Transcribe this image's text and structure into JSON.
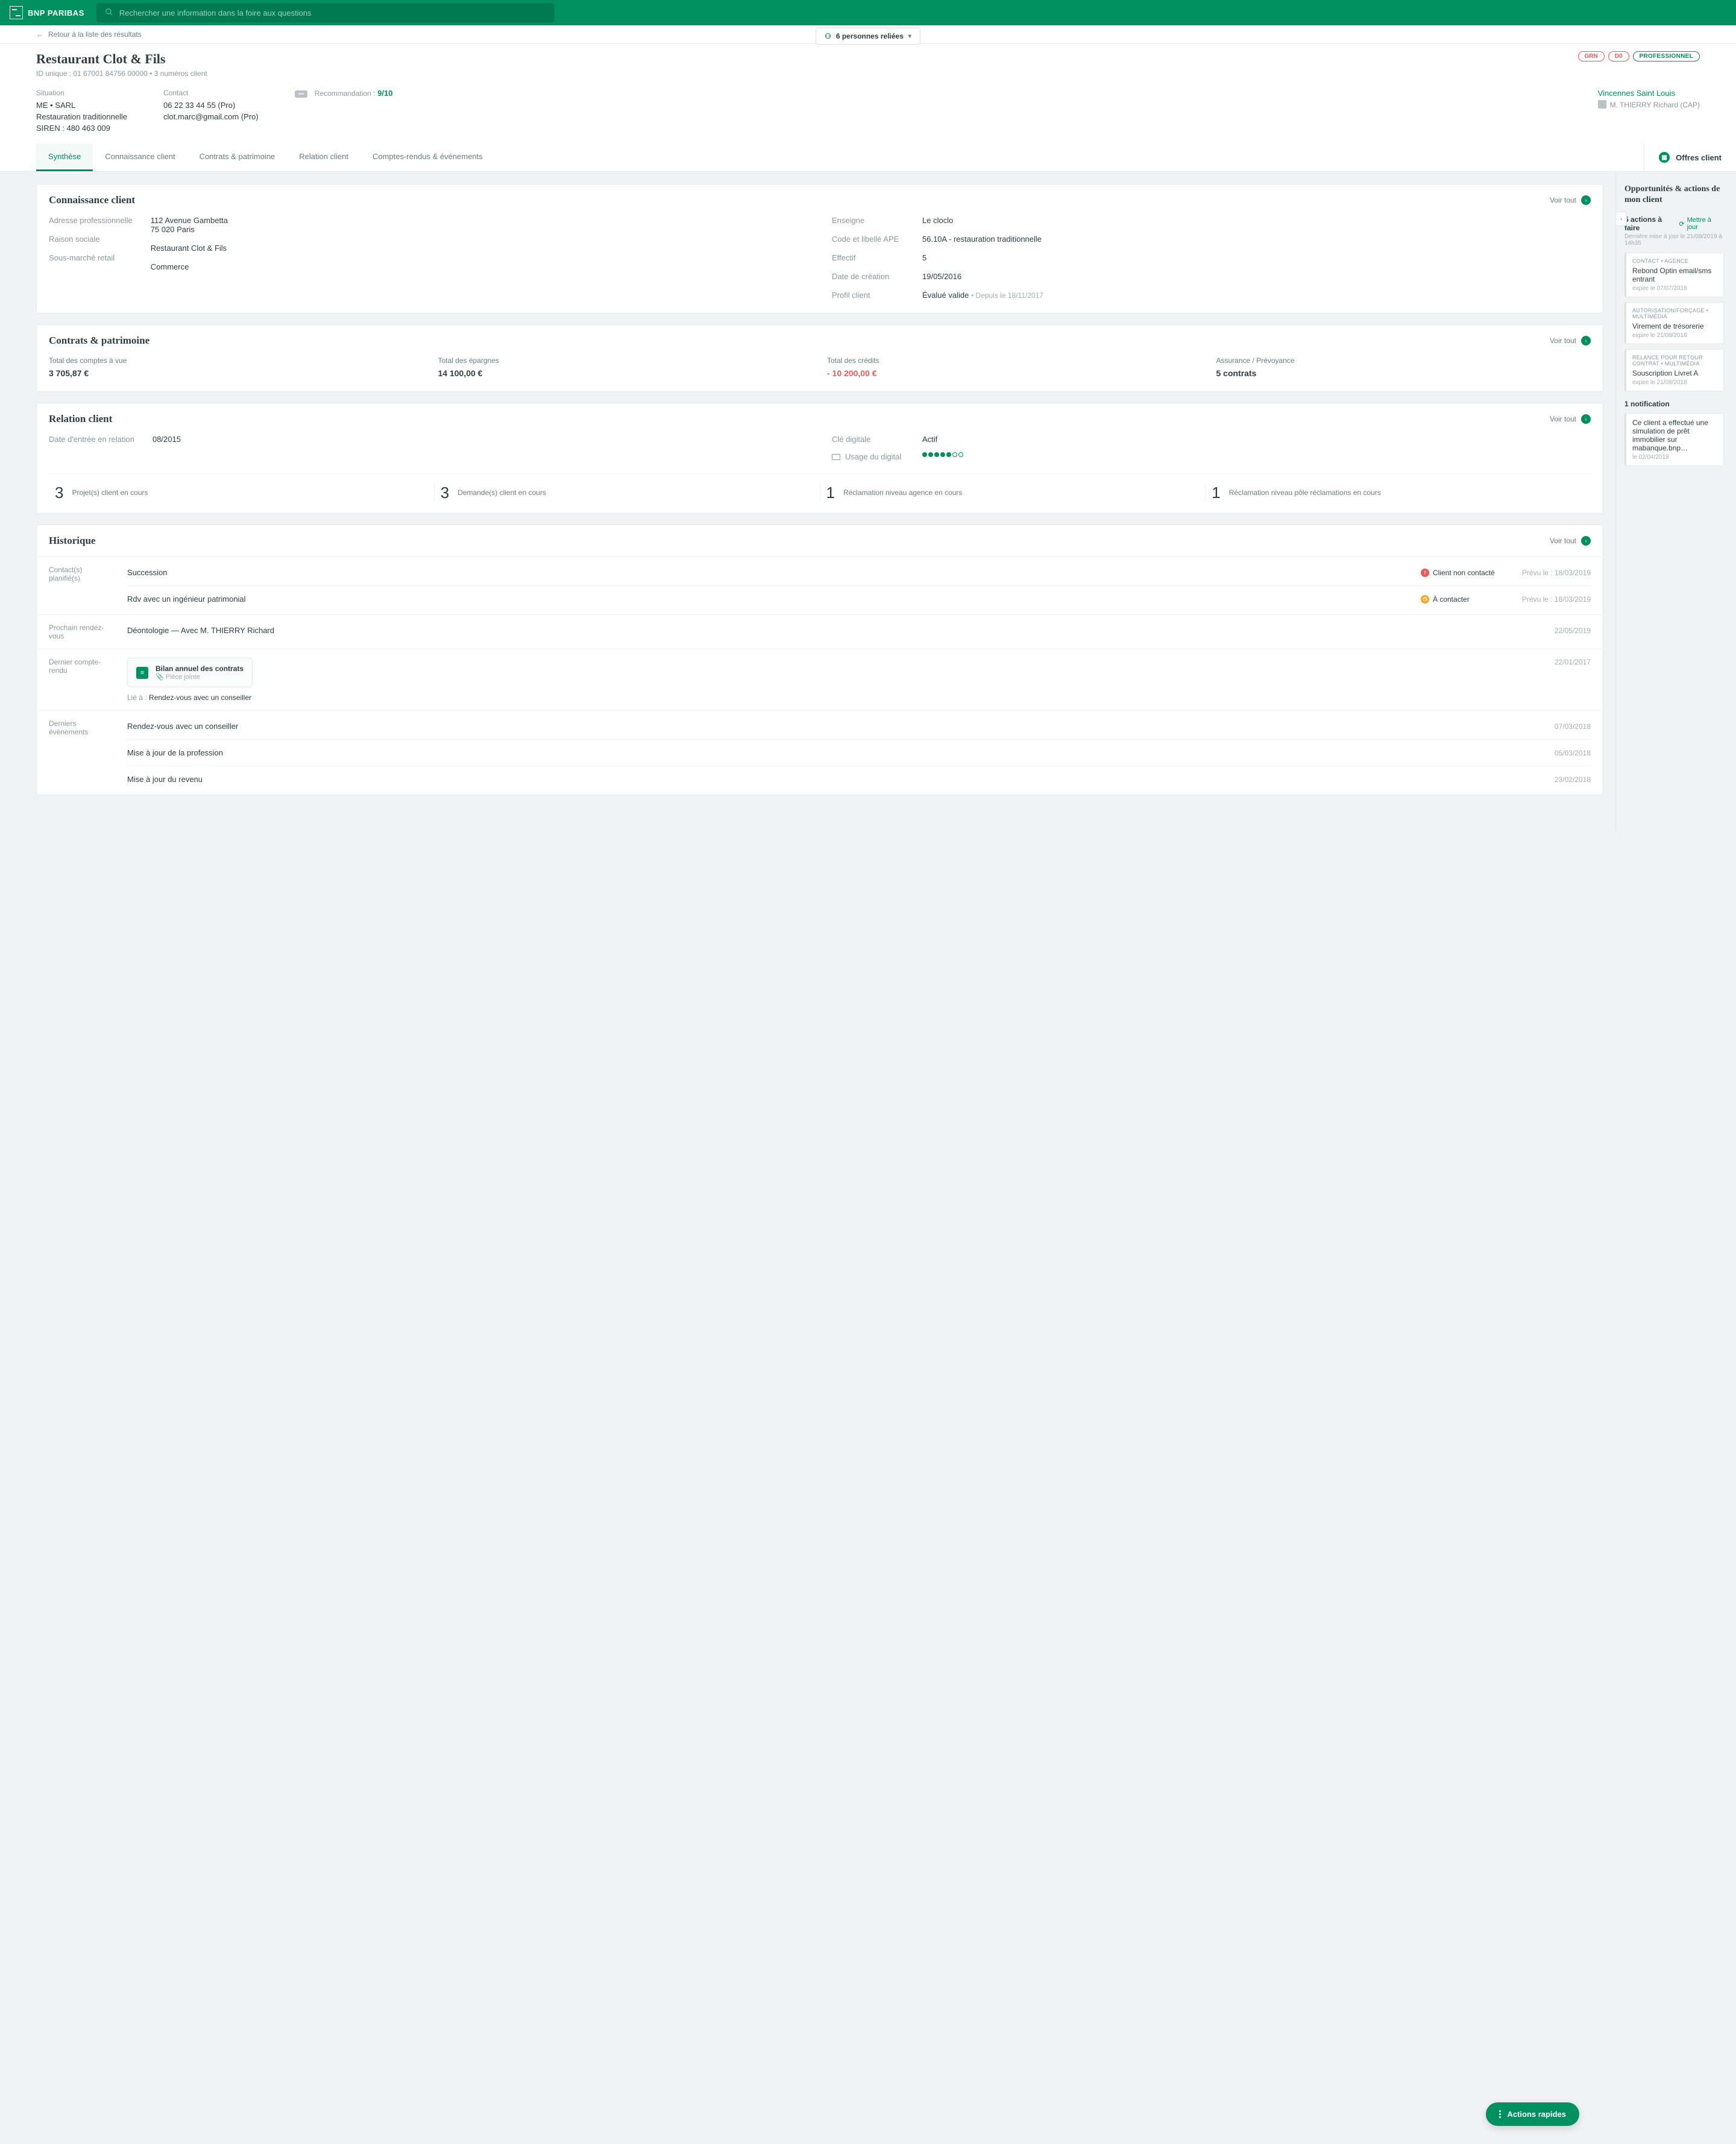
{
  "header": {
    "brand": "BNP PARIBAS",
    "search_placeholder": "Rechercher une information dans la foire aux questions"
  },
  "subbar": {
    "back": "Retour à la liste des résultats",
    "persons": "6 personnes reliées"
  },
  "client": {
    "name": "Restaurant Clot & Fils",
    "id_line": "ID unique : 01 67001 84756 00000 • 3 numéros client",
    "badges": {
      "grn": "GRN",
      "d0": "D0",
      "pro": "PROFESSIONNEL"
    },
    "situation_label": "Situation",
    "situation": "ME • SARL",
    "activity": "Restauration traditionnelle",
    "siren": "SIREN : 480 463 009",
    "contact_label": "Contact",
    "phone": "06 22 33 44 55 (Pro)",
    "email": "clot.marc@gmail.com (Pro)",
    "reco_label": "Recommandation :",
    "reco_value": "9/10",
    "agency": "Vincennes Saint Louis",
    "advisor": "M. THIERRY Richard (CAP)"
  },
  "tabs": [
    "Synthèse",
    "Connaissance client",
    "Contrats & patrimoine",
    "Relation client",
    "Comptes-rendus & événements"
  ],
  "offers_tab": "Offres client",
  "kc": {
    "title": "Connaissance client",
    "see_all": "Voir tout",
    "labels_left": [
      "Adresse professionnelle",
      "Raison sociale",
      "Sous-marché retail"
    ],
    "values_left": [
      "112 Avenue Gambetta\n75 020 Paris",
      "Restaurant Clot & Fils",
      "Commerce"
    ],
    "labels_right": [
      "Enseigne",
      "Code et libellé APE",
      "Effectif",
      "Date de création",
      "Profil client"
    ],
    "values_right": [
      "Le cloclo",
      "56.10A - restauration traditionnelle",
      "5",
      "19/05/2016"
    ],
    "profil_val": "Évalué valide",
    "profil_since": "• Depuis le 18/11/2017"
  },
  "cp": {
    "title": "Contrats & patrimoine",
    "see_all": "Voir tout",
    "items": [
      {
        "label": "Total des comptes à vue",
        "value": "3 705,87 €"
      },
      {
        "label": "Total des épargnes",
        "value": "14 100,00 €"
      },
      {
        "label": "Total des crédits",
        "value": "- 10 200,00 €",
        "neg": true
      },
      {
        "label": "Assurance / Prévoyance",
        "value": "5 contrats"
      }
    ]
  },
  "rc": {
    "title": "Relation client",
    "see_all": "Voir tout",
    "labels_left": [
      "Date d'entrée en relation"
    ],
    "values_left": [
      "08/2015"
    ],
    "cle_label": "Clé digitale",
    "cle_val": "Actif",
    "usage_label": "Usage du digital",
    "usage_filled": 5,
    "usage_total": 7,
    "stats": [
      {
        "n": "3",
        "t": "Projet(s) client en cours"
      },
      {
        "n": "3",
        "t": "Demande(s) client en cours"
      },
      {
        "n": "1",
        "t": "Réclamation niveau agence en cours"
      },
      {
        "n": "1",
        "t": "Réclamation niveau pôle réclamations en cours"
      }
    ]
  },
  "hist": {
    "title": "Historique",
    "see_all": "Voir tout",
    "contacts_label": "Contact(s) planifié(s)",
    "contacts": [
      {
        "title": "Succession",
        "status": "Client non contacté",
        "status_type": "red",
        "date": "Prévu le : 18/03/2019"
      },
      {
        "title": "Rdv avec un ingénieur patrimonial",
        "status": "À contacter",
        "status_type": "orange",
        "date": "Prévu le : 18/03/2019"
      }
    ],
    "next_rdv_label": "Prochain rendez-vous",
    "next_rdv": "Déontologie — Avec M. THIERRY Richard",
    "next_rdv_date": "22/05/2019",
    "last_cr_label": "Dernier compte-rendu",
    "attach_title": "Bilan annuel des contrats",
    "attach_sub": "Pièce jointe",
    "linked_label": "Lié à :",
    "linked_val": "Rendez-vous avec un conseiller",
    "last_cr_date": "22/01/2017",
    "last_evt_label": "Derniers évènements",
    "events": [
      {
        "title": "Rendez-vous avec un conseiller",
        "date": "07/03/2018"
      },
      {
        "title": "Mise à jour de la profession",
        "date": "05/03/2018"
      },
      {
        "title": "Mise à jour du revenu",
        "date": "23/02/2018"
      }
    ]
  },
  "side": {
    "title": "Opportunités & actions de mon client",
    "actions_count": "5 actions à faire",
    "update": "Mettre à jour",
    "last_update": "Dernière mise à jour le 21/08/2019 à 14h35",
    "actions": [
      {
        "cat": "CONTACT • AGENCE",
        "title": "Rebond Optin email/sms entrant",
        "exp": "expire le 07/07/2018"
      },
      {
        "cat": "AUTORISATION/FORÇAGE • MULTIMÉDIA",
        "title": "Virement de trésorerie",
        "exp": "expire le 21/08/2018"
      },
      {
        "cat": "RELANCE POUR RETOUR CONTRAT • MULTIMÉDIA",
        "title": "Souscription Livret A",
        "exp": "expire le 21/08/2018"
      }
    ],
    "notif_count": "1 notification",
    "notif": {
      "title": "Ce client a effectué une simulation de prêt immobilier sur mabanque.bnp…",
      "exp": "le 02/04/2018"
    }
  },
  "fab": "Actions rapides"
}
